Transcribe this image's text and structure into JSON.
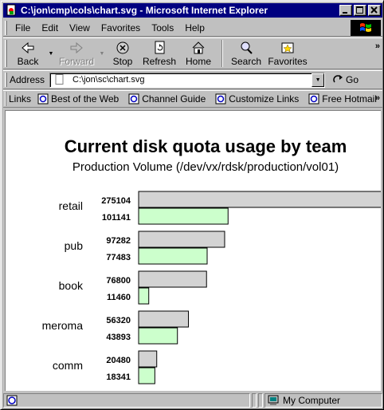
{
  "window": {
    "title": "C:\\jon\\cmp\\cols\\chart.svg - Microsoft Internet Explorer"
  },
  "menu": {
    "items": [
      {
        "label": "File"
      },
      {
        "label": "Edit"
      },
      {
        "label": "View"
      },
      {
        "label": "Favorites"
      },
      {
        "label": "Tools"
      },
      {
        "label": "Help"
      }
    ]
  },
  "toolbar": {
    "back_label": "Back",
    "forward_label": "Forward",
    "stop_label": "Stop",
    "refresh_label": "Refresh",
    "home_label": "Home",
    "search_label": "Search",
    "favorites_label": "Favorites",
    "more_label": "»"
  },
  "address": {
    "label": "Address",
    "value": "C:\\jon\\sc\\chart.svg",
    "go_label": "Go"
  },
  "links": {
    "label": "Links",
    "items": [
      {
        "label": "Best of the Web"
      },
      {
        "label": "Channel Guide"
      },
      {
        "label": "Customize Links"
      },
      {
        "label": "Free Hotmail"
      }
    ],
    "more_label": "»"
  },
  "status": {
    "zone_label": "My Computer"
  },
  "colors": {
    "title_bar": "#000080",
    "quota_bar": "#d3d3d3",
    "usage_bar": "#ccffcc"
  },
  "chart_data": {
    "type": "bar",
    "orientation": "horizontal",
    "title": "Current disk quota usage by team",
    "subtitle": "Production Volume (/dev/vx/rdsk/production/vol01)",
    "categories": [
      "retail",
      "pub",
      "book",
      "meroma",
      "comm"
    ],
    "series": [
      {
        "values": [
          275104,
          97282,
          76800,
          56320,
          20480
        ],
        "color": "#d3d3d3"
      },
      {
        "values": [
          101141,
          77483,
          11460,
          43893,
          18341
        ],
        "color": "#ccffcc"
      }
    ],
    "grid": false,
    "legend": "none"
  }
}
